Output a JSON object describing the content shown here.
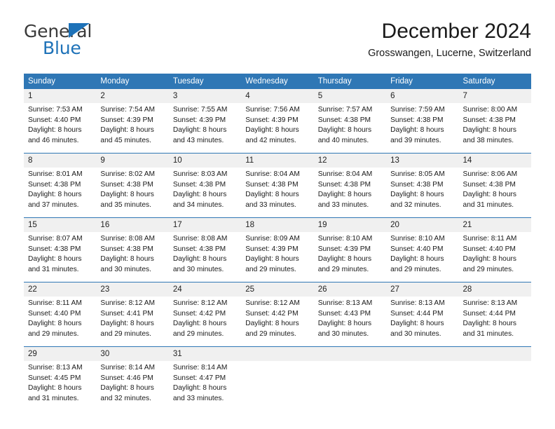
{
  "brand": {
    "name_top": "General",
    "name_bottom": "Blue",
    "triangle_color": "#1e72b8"
  },
  "header": {
    "title": "December 2024",
    "subtitle": "Grosswangen, Lucerne, Switzerland"
  },
  "theme": {
    "header_bg": "#2f77b5",
    "daynum_bg": "#f0f0f0",
    "rule_color": "#2f77b5"
  },
  "weekdays": [
    "Sunday",
    "Monday",
    "Tuesday",
    "Wednesday",
    "Thursday",
    "Friday",
    "Saturday"
  ],
  "weeks": [
    [
      {
        "day": "1",
        "sunrise": "Sunrise: 7:53 AM",
        "sunset": "Sunset: 4:40 PM",
        "daylight1": "Daylight: 8 hours",
        "daylight2": "and 46 minutes."
      },
      {
        "day": "2",
        "sunrise": "Sunrise: 7:54 AM",
        "sunset": "Sunset: 4:39 PM",
        "daylight1": "Daylight: 8 hours",
        "daylight2": "and 45 minutes."
      },
      {
        "day": "3",
        "sunrise": "Sunrise: 7:55 AM",
        "sunset": "Sunset: 4:39 PM",
        "daylight1": "Daylight: 8 hours",
        "daylight2": "and 43 minutes."
      },
      {
        "day": "4",
        "sunrise": "Sunrise: 7:56 AM",
        "sunset": "Sunset: 4:39 PM",
        "daylight1": "Daylight: 8 hours",
        "daylight2": "and 42 minutes."
      },
      {
        "day": "5",
        "sunrise": "Sunrise: 7:57 AM",
        "sunset": "Sunset: 4:38 PM",
        "daylight1": "Daylight: 8 hours",
        "daylight2": "and 40 minutes."
      },
      {
        "day": "6",
        "sunrise": "Sunrise: 7:59 AM",
        "sunset": "Sunset: 4:38 PM",
        "daylight1": "Daylight: 8 hours",
        "daylight2": "and 39 minutes."
      },
      {
        "day": "7",
        "sunrise": "Sunrise: 8:00 AM",
        "sunset": "Sunset: 4:38 PM",
        "daylight1": "Daylight: 8 hours",
        "daylight2": "and 38 minutes."
      }
    ],
    [
      {
        "day": "8",
        "sunrise": "Sunrise: 8:01 AM",
        "sunset": "Sunset: 4:38 PM",
        "daylight1": "Daylight: 8 hours",
        "daylight2": "and 37 minutes."
      },
      {
        "day": "9",
        "sunrise": "Sunrise: 8:02 AM",
        "sunset": "Sunset: 4:38 PM",
        "daylight1": "Daylight: 8 hours",
        "daylight2": "and 35 minutes."
      },
      {
        "day": "10",
        "sunrise": "Sunrise: 8:03 AM",
        "sunset": "Sunset: 4:38 PM",
        "daylight1": "Daylight: 8 hours",
        "daylight2": "and 34 minutes."
      },
      {
        "day": "11",
        "sunrise": "Sunrise: 8:04 AM",
        "sunset": "Sunset: 4:38 PM",
        "daylight1": "Daylight: 8 hours",
        "daylight2": "and 33 minutes."
      },
      {
        "day": "12",
        "sunrise": "Sunrise: 8:04 AM",
        "sunset": "Sunset: 4:38 PM",
        "daylight1": "Daylight: 8 hours",
        "daylight2": "and 33 minutes."
      },
      {
        "day": "13",
        "sunrise": "Sunrise: 8:05 AM",
        "sunset": "Sunset: 4:38 PM",
        "daylight1": "Daylight: 8 hours",
        "daylight2": "and 32 minutes."
      },
      {
        "day": "14",
        "sunrise": "Sunrise: 8:06 AM",
        "sunset": "Sunset: 4:38 PM",
        "daylight1": "Daylight: 8 hours",
        "daylight2": "and 31 minutes."
      }
    ],
    [
      {
        "day": "15",
        "sunrise": "Sunrise: 8:07 AM",
        "sunset": "Sunset: 4:38 PM",
        "daylight1": "Daylight: 8 hours",
        "daylight2": "and 31 minutes."
      },
      {
        "day": "16",
        "sunrise": "Sunrise: 8:08 AM",
        "sunset": "Sunset: 4:38 PM",
        "daylight1": "Daylight: 8 hours",
        "daylight2": "and 30 minutes."
      },
      {
        "day": "17",
        "sunrise": "Sunrise: 8:08 AM",
        "sunset": "Sunset: 4:38 PM",
        "daylight1": "Daylight: 8 hours",
        "daylight2": "and 30 minutes."
      },
      {
        "day": "18",
        "sunrise": "Sunrise: 8:09 AM",
        "sunset": "Sunset: 4:39 PM",
        "daylight1": "Daylight: 8 hours",
        "daylight2": "and 29 minutes."
      },
      {
        "day": "19",
        "sunrise": "Sunrise: 8:10 AM",
        "sunset": "Sunset: 4:39 PM",
        "daylight1": "Daylight: 8 hours",
        "daylight2": "and 29 minutes."
      },
      {
        "day": "20",
        "sunrise": "Sunrise: 8:10 AM",
        "sunset": "Sunset: 4:40 PM",
        "daylight1": "Daylight: 8 hours",
        "daylight2": "and 29 minutes."
      },
      {
        "day": "21",
        "sunrise": "Sunrise: 8:11 AM",
        "sunset": "Sunset: 4:40 PM",
        "daylight1": "Daylight: 8 hours",
        "daylight2": "and 29 minutes."
      }
    ],
    [
      {
        "day": "22",
        "sunrise": "Sunrise: 8:11 AM",
        "sunset": "Sunset: 4:40 PM",
        "daylight1": "Daylight: 8 hours",
        "daylight2": "and 29 minutes."
      },
      {
        "day": "23",
        "sunrise": "Sunrise: 8:12 AM",
        "sunset": "Sunset: 4:41 PM",
        "daylight1": "Daylight: 8 hours",
        "daylight2": "and 29 minutes."
      },
      {
        "day": "24",
        "sunrise": "Sunrise: 8:12 AM",
        "sunset": "Sunset: 4:42 PM",
        "daylight1": "Daylight: 8 hours",
        "daylight2": "and 29 minutes."
      },
      {
        "day": "25",
        "sunrise": "Sunrise: 8:12 AM",
        "sunset": "Sunset: 4:42 PM",
        "daylight1": "Daylight: 8 hours",
        "daylight2": "and 29 minutes."
      },
      {
        "day": "26",
        "sunrise": "Sunrise: 8:13 AM",
        "sunset": "Sunset: 4:43 PM",
        "daylight1": "Daylight: 8 hours",
        "daylight2": "and 30 minutes."
      },
      {
        "day": "27",
        "sunrise": "Sunrise: 8:13 AM",
        "sunset": "Sunset: 4:44 PM",
        "daylight1": "Daylight: 8 hours",
        "daylight2": "and 30 minutes."
      },
      {
        "day": "28",
        "sunrise": "Sunrise: 8:13 AM",
        "sunset": "Sunset: 4:44 PM",
        "daylight1": "Daylight: 8 hours",
        "daylight2": "and 31 minutes."
      }
    ],
    [
      {
        "day": "29",
        "sunrise": "Sunrise: 8:13 AM",
        "sunset": "Sunset: 4:45 PM",
        "daylight1": "Daylight: 8 hours",
        "daylight2": "and 31 minutes."
      },
      {
        "day": "30",
        "sunrise": "Sunrise: 8:14 AM",
        "sunset": "Sunset: 4:46 PM",
        "daylight1": "Daylight: 8 hours",
        "daylight2": "and 32 minutes."
      },
      {
        "day": "31",
        "sunrise": "Sunrise: 8:14 AM",
        "sunset": "Sunset: 4:47 PM",
        "daylight1": "Daylight: 8 hours",
        "daylight2": "and 33 minutes."
      },
      {
        "day": "",
        "sunrise": "",
        "sunset": "",
        "daylight1": "",
        "daylight2": ""
      },
      {
        "day": "",
        "sunrise": "",
        "sunset": "",
        "daylight1": "",
        "daylight2": ""
      },
      {
        "day": "",
        "sunrise": "",
        "sunset": "",
        "daylight1": "",
        "daylight2": ""
      },
      {
        "day": "",
        "sunrise": "",
        "sunset": "",
        "daylight1": "",
        "daylight2": ""
      }
    ]
  ]
}
